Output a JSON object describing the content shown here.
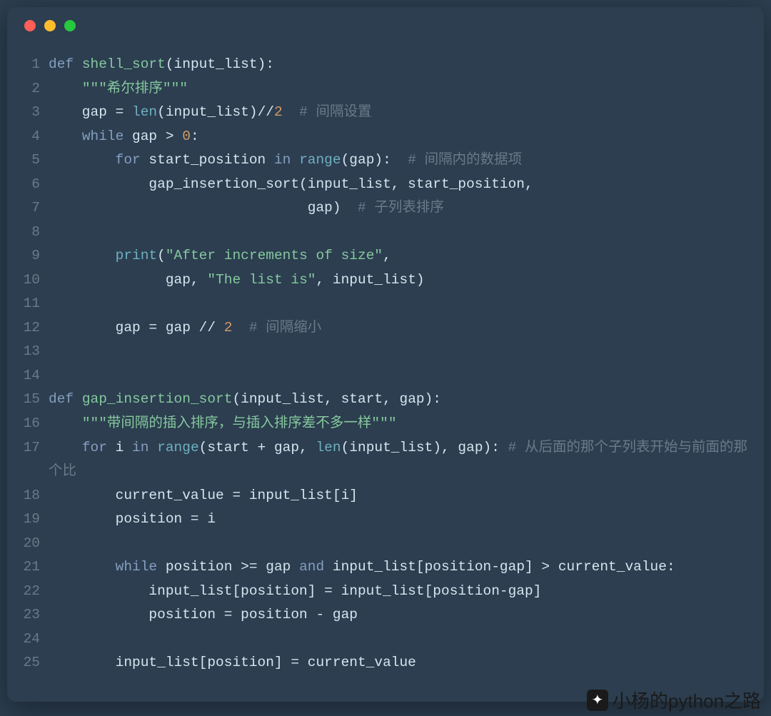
{
  "window": {
    "dots": [
      "red",
      "yellow",
      "green"
    ]
  },
  "watermark": {
    "text": "小杨的python之路"
  },
  "code": {
    "lines": [
      {
        "n": 1,
        "tokens": [
          [
            "kw",
            "def "
          ],
          [
            "fn",
            "shell_sort"
          ],
          [
            "op",
            "(input_list):"
          ]
        ]
      },
      {
        "n": 2,
        "tokens": [
          [
            "op",
            "    "
          ],
          [
            "str",
            "\"\"\"希尔排序\"\"\""
          ]
        ]
      },
      {
        "n": 3,
        "tokens": [
          [
            "op",
            "    gap = "
          ],
          [
            "builtin",
            "len"
          ],
          [
            "op",
            "(input_list)//"
          ],
          [
            "num",
            "2"
          ],
          [
            "op",
            "  "
          ],
          [
            "comment",
            "# 间隔设置"
          ]
        ]
      },
      {
        "n": 4,
        "tokens": [
          [
            "op",
            "    "
          ],
          [
            "kw",
            "while"
          ],
          [
            "op",
            " gap > "
          ],
          [
            "num",
            "0"
          ],
          [
            "op",
            ":"
          ]
        ]
      },
      {
        "n": 5,
        "tokens": [
          [
            "op",
            "        "
          ],
          [
            "kw",
            "for"
          ],
          [
            "op",
            " start_position "
          ],
          [
            "kw",
            "in"
          ],
          [
            "op",
            " "
          ],
          [
            "builtin",
            "range"
          ],
          [
            "op",
            "(gap):  "
          ],
          [
            "comment",
            "# 间隔内的数据项"
          ]
        ]
      },
      {
        "n": 6,
        "tokens": [
          [
            "op",
            "            gap_insertion_sort(input_list, start_position,"
          ]
        ]
      },
      {
        "n": 7,
        "tokens": [
          [
            "op",
            "                               gap)  "
          ],
          [
            "comment",
            "# 子列表排序"
          ]
        ]
      },
      {
        "n": 8,
        "tokens": [
          [
            "op",
            ""
          ]
        ]
      },
      {
        "n": 9,
        "tokens": [
          [
            "op",
            "        "
          ],
          [
            "builtin",
            "print"
          ],
          [
            "op",
            "("
          ],
          [
            "str",
            "\"After increments of size\""
          ],
          [
            "op",
            ","
          ]
        ]
      },
      {
        "n": 10,
        "tokens": [
          [
            "op",
            "              gap, "
          ],
          [
            "str",
            "\"The list is\""
          ],
          [
            "op",
            ", input_list)"
          ]
        ]
      },
      {
        "n": 11,
        "tokens": [
          [
            "op",
            ""
          ]
        ]
      },
      {
        "n": 12,
        "tokens": [
          [
            "op",
            "        gap = gap // "
          ],
          [
            "num",
            "2"
          ],
          [
            "op",
            "  "
          ],
          [
            "comment",
            "# 间隔缩小"
          ]
        ]
      },
      {
        "n": 13,
        "tokens": [
          [
            "op",
            ""
          ]
        ]
      },
      {
        "n": 14,
        "tokens": [
          [
            "op",
            ""
          ]
        ]
      },
      {
        "n": 15,
        "tokens": [
          [
            "kw",
            "def "
          ],
          [
            "fn",
            "gap_insertion_sort"
          ],
          [
            "op",
            "(input_list, start, gap):"
          ]
        ]
      },
      {
        "n": 16,
        "tokens": [
          [
            "op",
            "    "
          ],
          [
            "str",
            "\"\"\"带间隔的插入排序，与插入排序差不多一样\"\"\""
          ]
        ]
      },
      {
        "n": 17,
        "tokens": [
          [
            "op",
            "    "
          ],
          [
            "kw",
            "for"
          ],
          [
            "op",
            " i "
          ],
          [
            "kw",
            "in"
          ],
          [
            "op",
            " "
          ],
          [
            "builtin",
            "range"
          ],
          [
            "op",
            "(start + gap, "
          ],
          [
            "builtin",
            "len"
          ],
          [
            "op",
            "(input_list), gap): "
          ],
          [
            "comment",
            "# 从后面的那个子列表开始与前面的那个比"
          ]
        ],
        "wrap": true
      },
      {
        "n": 18,
        "tokens": [
          [
            "op",
            "        current_value = input_list[i]"
          ]
        ]
      },
      {
        "n": 19,
        "tokens": [
          [
            "op",
            "        position = i"
          ]
        ]
      },
      {
        "n": 20,
        "tokens": [
          [
            "op",
            ""
          ]
        ]
      },
      {
        "n": 21,
        "tokens": [
          [
            "op",
            "        "
          ],
          [
            "kw",
            "while"
          ],
          [
            "op",
            " position >= gap "
          ],
          [
            "kw",
            "and"
          ],
          [
            "op",
            " input_list[position-gap] > current_value:"
          ]
        ]
      },
      {
        "n": 22,
        "tokens": [
          [
            "op",
            "            input_list[position] = input_list[position-gap]"
          ]
        ]
      },
      {
        "n": 23,
        "tokens": [
          [
            "op",
            "            position = position - gap"
          ]
        ]
      },
      {
        "n": 24,
        "tokens": [
          [
            "op",
            ""
          ]
        ]
      },
      {
        "n": 25,
        "tokens": [
          [
            "op",
            "        input_list[position] = current_value"
          ]
        ]
      }
    ]
  }
}
